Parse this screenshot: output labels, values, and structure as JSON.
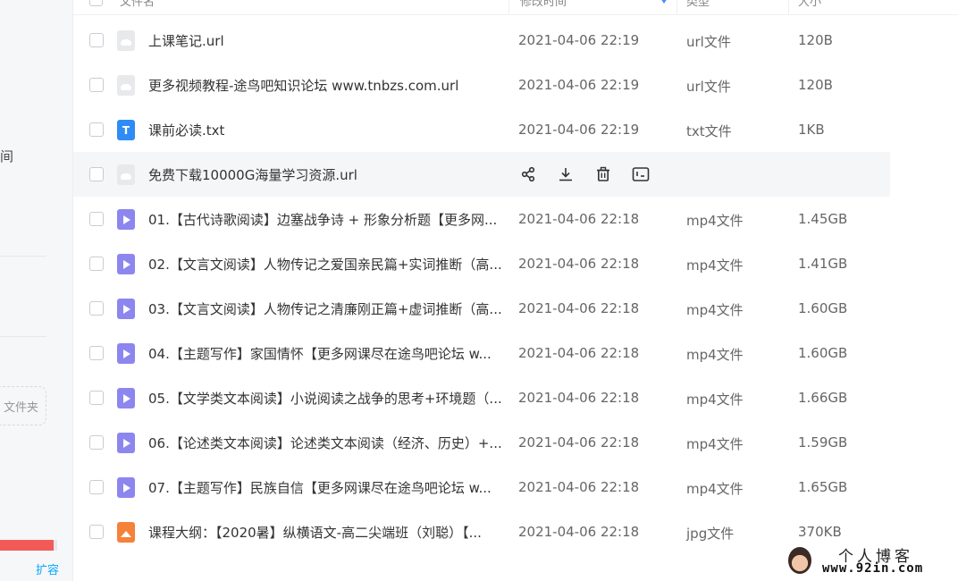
{
  "sidebar": {
    "partial_text": "间",
    "new_folder_partial": "文件夹",
    "storage_used_fraction": 0.93,
    "expand_label": "扩容"
  },
  "header": {
    "col_name": "文件名",
    "col_time": "修改时间",
    "col_type": "类型",
    "col_size": "大小"
  },
  "files": [
    {
      "name": "上课笔记.url",
      "time": "2021-04-06 22:19",
      "type": "url文件",
      "size": "120B",
      "icon": "link-file-icon"
    },
    {
      "name": "更多视频教程-途鸟吧知识论坛 www.tnbzs.com.url",
      "time": "2021-04-06 22:19",
      "type": "url文件",
      "size": "120B",
      "icon": "link-file-icon"
    },
    {
      "name": "课前必读.txt",
      "time": "2021-04-06 22:19",
      "type": "txt文件",
      "size": "1KB",
      "icon": "text-file-icon"
    },
    {
      "name": "免费下载10000G海量学习资源.url",
      "time": "",
      "type": "",
      "size": "",
      "icon": "link-file-icon"
    },
    {
      "name": "01.【古代诗歌阅读】边塞战争诗 + 形象分析题【更多网...",
      "time": "2021-04-06 22:18",
      "type": "mp4文件",
      "size": "1.45GB",
      "icon": "video-file-icon"
    },
    {
      "name": "02.【文言文阅读】人物传记之爱国亲民篇+实词推断（高...",
      "time": "2021-04-06 22:18",
      "type": "mp4文件",
      "size": "1.41GB",
      "icon": "video-file-icon"
    },
    {
      "name": "03.【文言文阅读】人物传记之清廉刚正篇+虚词推断（高...",
      "time": "2021-04-06 22:18",
      "type": "mp4文件",
      "size": "1.60GB",
      "icon": "video-file-icon"
    },
    {
      "name": "04.【主题写作】家国情怀【更多网课尽在途鸟吧论坛 w...",
      "time": "2021-04-06 22:18",
      "type": "mp4文件",
      "size": "1.60GB",
      "icon": "video-file-icon"
    },
    {
      "name": "05.【文学类文本阅读】小说阅读之战争的思考+环境题（...",
      "time": "2021-04-06 22:18",
      "type": "mp4文件",
      "size": "1.66GB",
      "icon": "video-file-icon"
    },
    {
      "name": "06.【论述类文本阅读】论述类文本阅读（经济、历史）+...",
      "time": "2021-04-06 22:18",
      "type": "mp4文件",
      "size": "1.59GB",
      "icon": "video-file-icon"
    },
    {
      "name": "07.【主题写作】民族自信【更多网课尽在途鸟吧论坛 w...",
      "time": "2021-04-06 22:18",
      "type": "mp4文件",
      "size": "1.65GB",
      "icon": "video-file-icon"
    },
    {
      "name": "课程大纲：【2020暑】纵横语文-高二尖端班（刘聪）【...",
      "time": "2021-04-06 22:18",
      "type": "jpg文件",
      "size": "370KB",
      "icon": "image-file-icon"
    }
  ],
  "row_actions": [
    "share-icon",
    "download-icon",
    "delete-icon",
    "more-icon"
  ],
  "watermark": {
    "line1": "个人博客",
    "line2": "www.92in.com"
  },
  "colors": {
    "accent": "#06a7ff",
    "storage_bar": "#f25a5a",
    "video_icon": "#8d86ef",
    "text_icon": "#2f8cf6",
    "image_icon": "#f5813a"
  }
}
